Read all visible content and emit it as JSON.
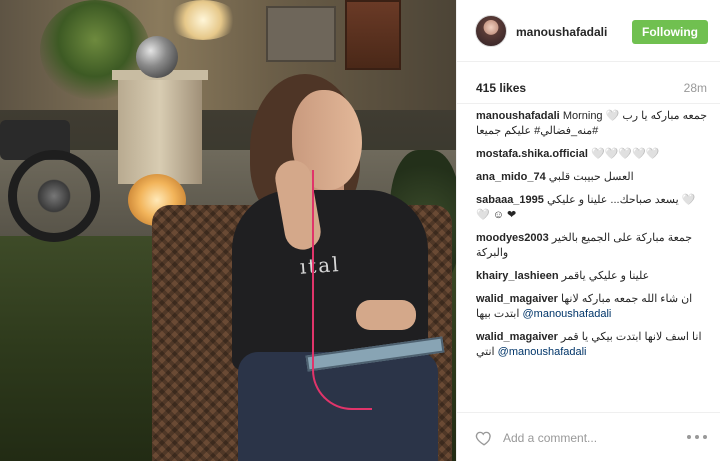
{
  "post": {
    "username": "manoushafadali",
    "follow_label": "Following",
    "likes": "415 likes",
    "time": "28m",
    "photo_text": "ıtal"
  },
  "comments": [
    {
      "user": "manoushafadali",
      "text": "Morning 🤍 جمعه مباركه يا رب #منه_فضالي# عليكم جميعا",
      "mention": ""
    },
    {
      "user": "mostafa.shika.official",
      "text": "🤍🤍🤍🤍🤍",
      "mention": ""
    },
    {
      "user": "ana_mido_74",
      "text": "العسل حبيبت قلبي",
      "mention": ""
    },
    {
      "user": "sabaaa_1995",
      "text": "يسعد صباحك... علينا و عليكي 🤍🤍 ☺ ❤",
      "mention": ""
    },
    {
      "user": "moodyes2003",
      "text": "جمعة مباركة على الجميع بالخير والبركة",
      "mention": ""
    },
    {
      "user": "khairy_lashieen",
      "text": "علينا و عليكي ياقمر",
      "mention": ""
    },
    {
      "user": "walid_magaiver",
      "text": "ان شاء الله جمعه مباركه لانها ابتدت بيها",
      "mention": "@manoushafadali"
    },
    {
      "user": "walid_magaiver",
      "text": "انا اسف لانها ابتدت بيكي يا قمر انتي",
      "mention": "@manoushafadali"
    }
  ],
  "footer": {
    "add_comment_placeholder": "Add a comment...",
    "heart_icon": "heart-outline-icon",
    "more_icon": "more-options-icon"
  },
  "colors": {
    "follow_button": "#70c050",
    "mention": "#003569",
    "muted": "#999999"
  }
}
